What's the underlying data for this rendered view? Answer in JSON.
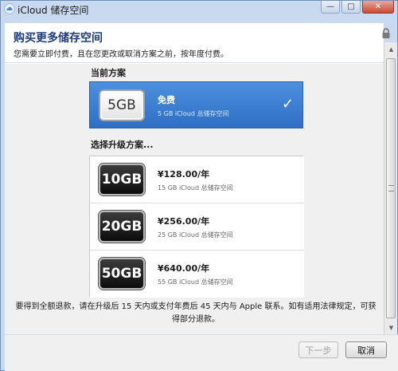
{
  "window": {
    "title": "iCloud 储存空间",
    "close_glyph": "✕",
    "minimize_glyph": "—",
    "maximize_glyph": "□"
  },
  "header": {
    "title": "购买更多储存空间",
    "subtitle": "您需要立即付费，且在您更改或取消方案之前，按年度付费。"
  },
  "current_plan": {
    "section_label": "当前方案",
    "badge": "5GB",
    "price": "免费",
    "description": "5 GB iCloud 总储存空间",
    "check_glyph": "✓"
  },
  "upgrade": {
    "section_label": "选择升级方案...",
    "plans": [
      {
        "badge": "10GB",
        "price": "¥128.00/年",
        "description": "15 GB iCloud 总储存空间"
      },
      {
        "badge": "20GB",
        "price": "¥256.00/年",
        "description": "25 GB iCloud 总储存空间"
      },
      {
        "badge": "50GB",
        "price": "¥640.00/年",
        "description": "55 GB iCloud 总储存空间"
      }
    ]
  },
  "refund_notice": "要得到全额退款，请在升级后 15 天内或支付年费后 45 天内与 Apple 联系。如有适用法律规定，可获得部分退款。",
  "scrollbar": {
    "up_glyph": "▲",
    "down_glyph": "▼"
  },
  "footer": {
    "next_label": "下一步",
    "cancel_label": "取消"
  },
  "colors": {
    "accent_blue": "#3a7bd5",
    "heading_blue": "#1d3c7a",
    "close_red": "#c84a33"
  }
}
